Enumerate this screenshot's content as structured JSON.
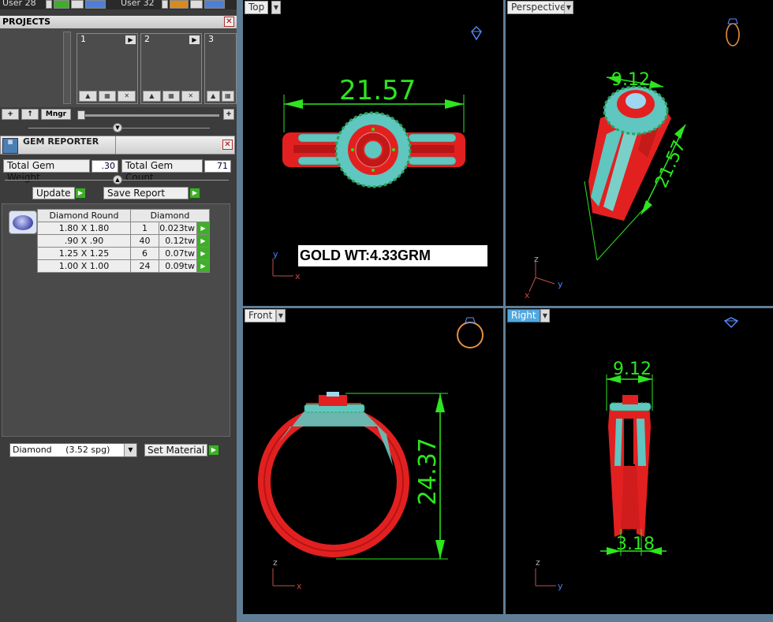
{
  "users": {
    "user_a": "User 28",
    "user_b": "User 32"
  },
  "projects": {
    "title": "PROJECTS",
    "slots": [
      "1",
      "2",
      "3"
    ],
    "manager_label": "Mngr"
  },
  "gem_reporter": {
    "title": "GEM REPORTER",
    "total_weight_label": "Total Gem Weight",
    "total_weight_value": ".30",
    "total_count_label": "Total Gem Count",
    "total_count_value": "71",
    "update_label": "Update",
    "save_report_label": "Save Report",
    "table": {
      "headers": [
        "Diamond Round",
        "Diamond"
      ],
      "rows": [
        {
          "size": "1.80 X 1.80",
          "count": "1",
          "weight": "0.023tw"
        },
        {
          "size": ".90 X .90",
          "count": "40",
          "weight": "0.12tw"
        },
        {
          "size": "1.25 X 1.25",
          "count": "6",
          "weight": "0.07tw"
        },
        {
          "size": "1.00 X 1.00",
          "count": "24",
          "weight": "0.09tw"
        }
      ]
    },
    "material_select": "Diamond     (3.52 spg)",
    "set_material_label": "Set Material"
  },
  "viewports": {
    "top": {
      "label": "Top",
      "dimension": "21.57",
      "note": "GOLD WT:4.33GRM"
    },
    "perspective": {
      "label": "Perspective",
      "dim_a": "9.12",
      "dim_b": "21.57"
    },
    "front": {
      "label": "Front",
      "dimension": "24.37"
    },
    "right": {
      "label": "Right",
      "dim_a": "9.12",
      "dim_b": "3.18"
    }
  },
  "axes": {
    "x": "x",
    "y": "y",
    "z": "z"
  },
  "colors": {
    "accent_tab": "#52a8e0",
    "dimension_green": "#2ee51f",
    "metal_red": "#e32020",
    "gem_teal": "#5fc6c0",
    "panel_gray": "#3c3c3c"
  }
}
